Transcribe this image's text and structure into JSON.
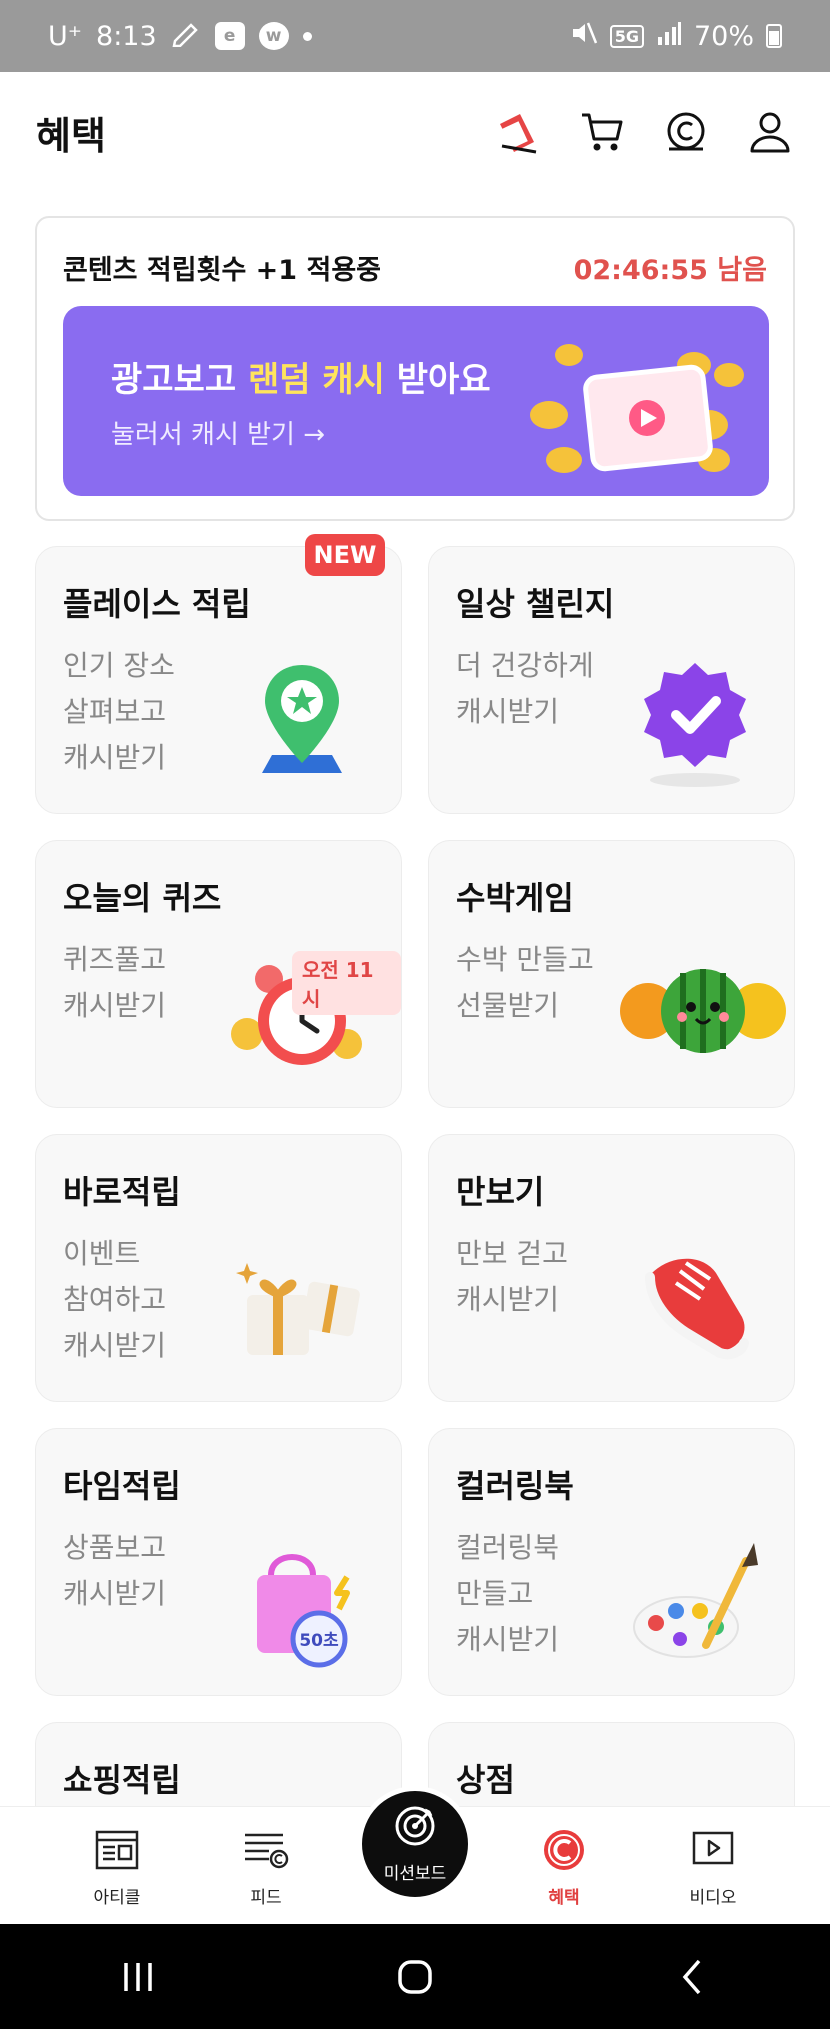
{
  "status_bar": {
    "carrier": "U⁺",
    "time": "8:13",
    "badge1": "e",
    "badge2": "w",
    "network": "5G",
    "battery": "70%"
  },
  "header": {
    "title": "혜택"
  },
  "promo": {
    "status_text": "콘텐츠 적립횟수 +1 적용중",
    "timer": "02:46:55 남음",
    "ad_title_pre": "광고보고 ",
    "ad_title_highlight": "랜덤 캐시",
    "ad_title_post": " 받아요",
    "ad_subtitle": "눌러서 캐시 받기 →"
  },
  "new_badge": "NEW",
  "cards": [
    {
      "title": "플레이스 적립",
      "desc": [
        "인기 장소",
        "살펴보고",
        "캐시받기"
      ],
      "icon": "map-pin-star-icon"
    },
    {
      "title": "일상 챌린지",
      "desc": [
        "더 건강하게",
        "캐시받기"
      ],
      "icon": "verified-badge-icon"
    },
    {
      "title": "오늘의 퀴즈",
      "desc": [
        "퀴즈풀고",
        "캐시받기"
      ],
      "icon": "alarm-clock-icon",
      "tag": "오전 11시"
    },
    {
      "title": "수박게임",
      "desc": [
        "수박 만들고",
        "선물받기"
      ],
      "icon": "watermelon-icon"
    },
    {
      "title": "바로적립",
      "desc": [
        "이벤트",
        "참여하고",
        "캐시받기"
      ],
      "icon": "gift-box-icon"
    },
    {
      "title": "만보기",
      "desc": [
        "만보 걷고",
        "캐시받기"
      ],
      "icon": "sneaker-icon"
    },
    {
      "title": "타임적립",
      "desc": [
        "상품보고",
        "캐시받기"
      ],
      "icon": "shopping-bag-timer-icon",
      "tag": "50초"
    },
    {
      "title": "컬러링북",
      "desc": [
        "컬러링북",
        "만들고",
        "캐시받기"
      ],
      "icon": "paint-palette-icon"
    },
    {
      "title": "쇼핑적립",
      "desc": [],
      "icon": ""
    },
    {
      "title": "상점",
      "desc": [],
      "icon": ""
    }
  ],
  "bottom_nav": {
    "articles": "아티클",
    "feed": "피드",
    "mission_board": "미션보드",
    "benefits": "혜택",
    "video": "비디오"
  },
  "colors": {
    "accent_red": "#e0524e",
    "ad_purple": "#8a6cf0",
    "highlight_yellow": "#ffe45c",
    "new_badge_red": "#ee4747"
  }
}
